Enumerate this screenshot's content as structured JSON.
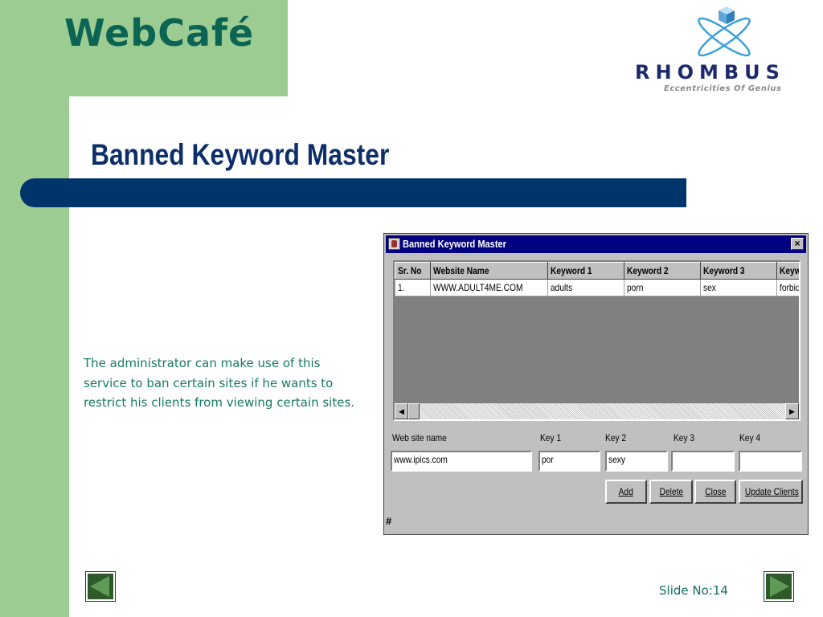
{
  "brand": "WebCafé",
  "logo": {
    "company": "RHOMBUS",
    "tagline": "Eccentricities Of Genius"
  },
  "slide": {
    "title": "Banned Keyword Master",
    "description": "The administrator can make use of this service to ban certain sites if he wants to restrict his clients from viewing certain sites.",
    "slide_no": "Slide No:14"
  },
  "window": {
    "title": "Banned Keyword Master",
    "close_glyph": "×",
    "table": {
      "headers": [
        "Sr. No",
        "Website Name",
        "Keyword 1",
        "Keyword 2",
        "Keyword 3",
        "Keyw"
      ],
      "rows": [
        [
          "1.",
          "WWW.ADULT4ME.COM",
          "adults",
          "porn",
          "sex",
          "forbid"
        ]
      ]
    },
    "form": {
      "labels": {
        "website": "Web site name",
        "key1": "Key 1",
        "key2": "Key 2",
        "key3": "Key 3",
        "key4": "Key 4"
      },
      "values": {
        "website": "www.ipics.com",
        "key1": "por",
        "key2": "sexy",
        "key3": "",
        "key4": ""
      }
    },
    "buttons": {
      "add": "Add",
      "delete": "Delete",
      "close": "Close",
      "update": "Update Clients"
    },
    "status": "#"
  },
  "colors": {
    "sidebar_green": "#9ccc92",
    "brand_teal": "#0b6454",
    "title_navy": "#0c2f6a",
    "bar_navy": "#01346a",
    "body_text_teal": "#167a66",
    "window_titlebar": "#000080"
  },
  "icons": {
    "prev": "triangle-left",
    "next": "triangle-right",
    "logo": "rhombus-cube-orbit"
  }
}
